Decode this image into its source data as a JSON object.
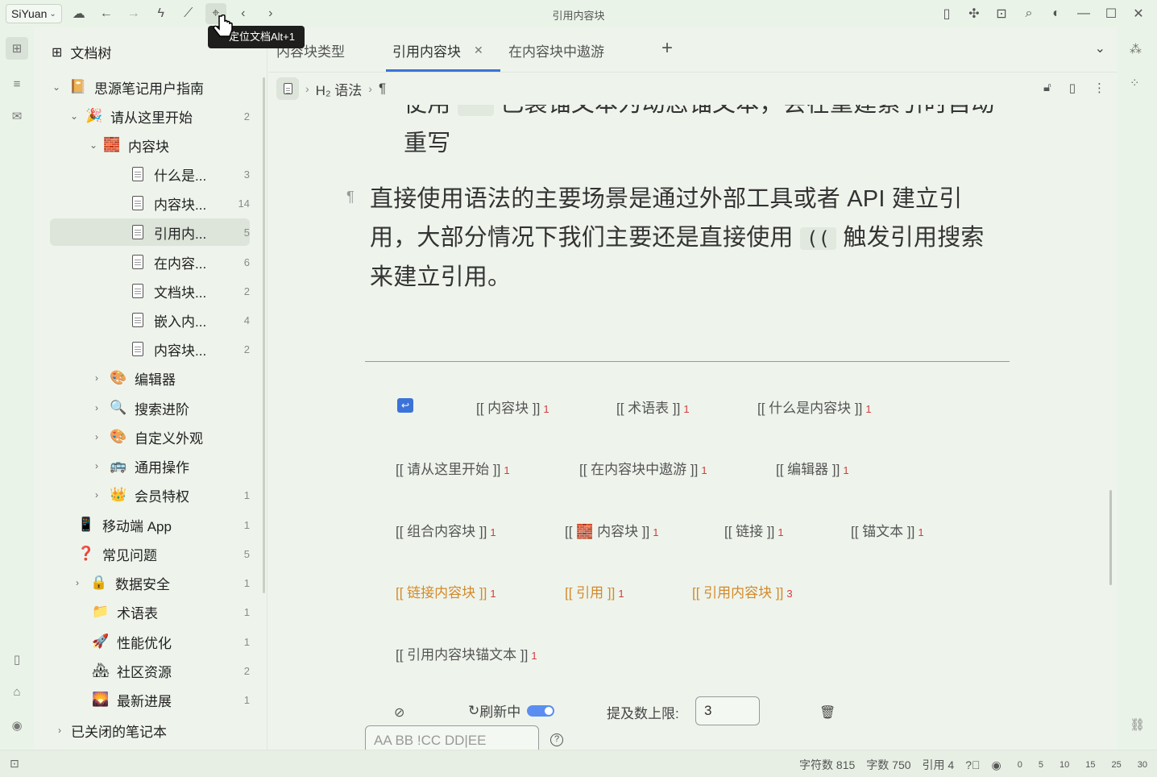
{
  "app": {
    "brand": "SiYuan",
    "window_title": "引用内容块",
    "tooltip": "定位文档Alt+1"
  },
  "tree": {
    "title": "文档树",
    "items": [
      {
        "label": "思源笔记用户指南",
        "count": ""
      },
      {
        "label": "请从这里开始",
        "count": "2"
      },
      {
        "label": "内容块",
        "count": ""
      },
      {
        "label": "什么是...",
        "count": "3"
      },
      {
        "label": "内容块...",
        "count": "14"
      },
      {
        "label": "引用内...",
        "count": "5"
      },
      {
        "label": "在内容...",
        "count": "6"
      },
      {
        "label": "文档块...",
        "count": "2"
      },
      {
        "label": "嵌入内...",
        "count": "4"
      },
      {
        "label": "内容块...",
        "count": "2"
      },
      {
        "label": "编辑器",
        "count": ""
      },
      {
        "label": "搜索进阶",
        "count": ""
      },
      {
        "label": "自定义外观",
        "count": ""
      },
      {
        "label": "通用操作",
        "count": ""
      },
      {
        "label": "会员特权",
        "count": "1"
      },
      {
        "label": "移动端 App",
        "count": "1"
      },
      {
        "label": "常见问题",
        "count": "5"
      },
      {
        "label": "数据安全",
        "count": "1"
      },
      {
        "label": "术语表",
        "count": "1"
      },
      {
        "label": "性能优化",
        "count": "1"
      },
      {
        "label": "社区资源",
        "count": "2"
      },
      {
        "label": "最新进展",
        "count": "1"
      },
      {
        "label": "已关闭的笔记本",
        "count": ""
      }
    ]
  },
  "tabs": [
    {
      "label": "内容块类型"
    },
    {
      "label": "引用内容块"
    },
    {
      "label": "在内容块中遨游"
    }
  ],
  "breadcrumb": {
    "heading": "H₂ 语法",
    "para": "¶"
  },
  "content": {
    "p1_line1": "使用 ",
    "p1_line1_rest": " 已装锚文本为动态锚文本，会在重建索引时自动",
    "p1_line2": "重写",
    "p2_line1": "直接使用语法的主要场景是通过外部工具或者 API 建立引",
    "p2_line2a": "用，大部分情况下我们主要还是直接使用 ",
    "p2_code": "((",
    "p2_line2b": " 触发引用搜索",
    "p2_line3": "来建立引用。"
  },
  "tags": [
    {
      "text": "[[ 内容块 ]]",
      "n": "1"
    },
    {
      "text": "[[ 术语表 ]]",
      "n": "1"
    },
    {
      "text": "[[ 什么是内容块 ]]",
      "n": "1"
    },
    {
      "text": "[[ 请从这里开始 ]]",
      "n": "1"
    },
    {
      "text": "[[ 在内容块中遨游 ]]",
      "n": "1"
    },
    {
      "text": "[[ 编辑器 ]]",
      "n": "1"
    },
    {
      "text": "[[ 组合内容块 ]]",
      "n": "1"
    },
    {
      "text": "内容块 ]]",
      "n": "1"
    },
    {
      "text": "[[ 链接 ]]",
      "n": "1"
    },
    {
      "text": "[[ 锚文本 ]]",
      "n": "1"
    },
    {
      "text": "[[ 链接内容块 ]]",
      "n": "1"
    },
    {
      "text": "[[ 引用 ]]",
      "n": "1"
    },
    {
      "text": "[[ 引用内容块 ]]",
      "n": "3"
    },
    {
      "text": "[[ 引用内容块锚文本 ]]",
      "n": "1"
    }
  ],
  "controls": {
    "refresh_label": "刷新中",
    "limit_label": "提及数上限:",
    "limit_value": "3",
    "filter_placeholder": "AA BB !CC DD|EE"
  },
  "status": {
    "chars": "字符数 815",
    "words": "字数 750",
    "refs": "引用 4",
    "zoom": [
      "0",
      "5",
      "10",
      "15",
      "25",
      "30"
    ]
  },
  "colors": {
    "accent": "#3b73d8",
    "tag_orange": "#d4892a",
    "count_red": "#d23c3c",
    "background": "#eef4ec"
  }
}
